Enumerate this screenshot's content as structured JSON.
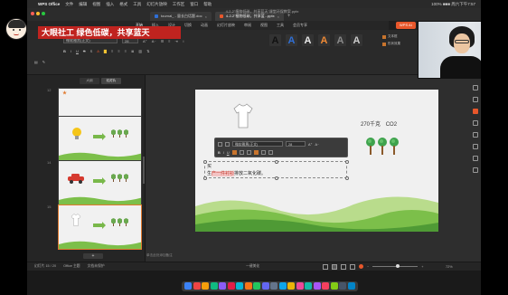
{
  "menubar": {
    "app": "WPS Office",
    "items": [
      "文件",
      "编辑",
      "视图",
      "插入",
      "格式",
      "工具",
      "幻灯片放映",
      "工作区",
      "窗口",
      "帮助"
    ],
    "status_text": "100% ■■■  周六下午7:57"
  },
  "window": {
    "title": "4-2-2\"植物低碳，共享蓝天\"课堂环保教案.pptx",
    "tabs": [
      {
        "label": "tournal_ - 量长白话题.doc"
      },
      {
        "label": "4-2-2\"植物低碳，共享蓝...pptx"
      }
    ]
  },
  "ribbon": {
    "file_label": "三 文件",
    "tabs": [
      "开始",
      "插入",
      "设计",
      "切换",
      "动画",
      "幻灯片放映",
      "审阅",
      "视图",
      "工具",
      "会员专享"
    ],
    "selected_tab": "开始",
    "ai_label": "WPS AI",
    "font_name": "微软雅黑(正文)",
    "font_size": "28",
    "style_letters": [
      "A",
      "A",
      "A",
      "A",
      "A",
      "A"
    ],
    "style_colors": [
      "#111111",
      "#2f6fd6",
      "#e9e9e9",
      "#ef8a35",
      "#8a8a8a",
      "#cccccc"
    ],
    "style_btn_1": "文本框",
    "style_btn_2": "形状效果"
  },
  "panel": {
    "tab_outline": "大纲",
    "tab_slides": "幻灯片",
    "slide_numbers": [
      "12",
      "13",
      "14",
      "15"
    ],
    "notes_hint": "单击此处添加备注",
    "add_label": "+"
  },
  "slide": {
    "co2_label": "270千克",
    "co2_unit": "CO2",
    "text_line1": "买",
    "text_line2_pre": "生",
    "text_line2_hl": "产一件衬衫",
    "text_line2_post": "排放二氧化碳。"
  },
  "floating_toolbar": {
    "font": "微软雅黑(正文)",
    "size": "28"
  },
  "status": {
    "slide_info": "幻灯片 15 / 20",
    "theme": "Office 主题",
    "doc_protect": "文档未保护",
    "notes": "一键美化",
    "zoom": "72%",
    "zoom_fraction": 0.56
  },
  "overlay": {
    "banner_text": "大眼社工 绿色低碳，共享蓝天"
  },
  "colors": {
    "accent_orange": "#e07a2f",
    "banner_red": "#c0231f",
    "tree_green": "#3fa34d"
  }
}
